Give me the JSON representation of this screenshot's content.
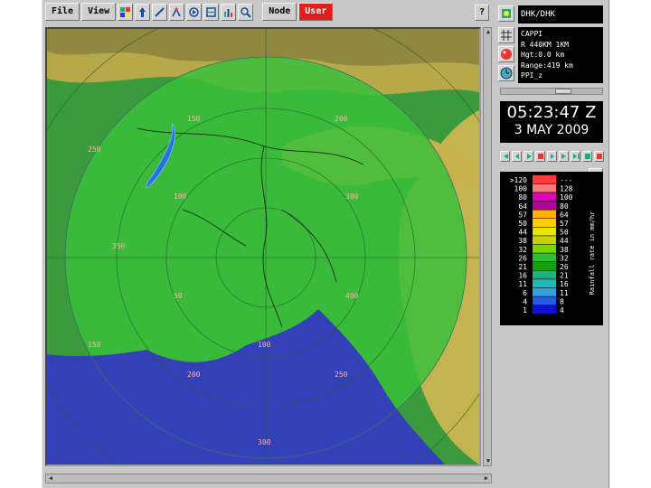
{
  "toolbar": {
    "file_label": "File",
    "view_label": "View",
    "node_label": "Node",
    "user_label": "User",
    "help_label": "?",
    "tool_icons": [
      "layers-icon",
      "up-arrow-icon",
      "line-icon",
      "cross-section-icon",
      "animation-icon",
      "overlay-icon",
      "statistics-icon",
      "zoom-icon"
    ]
  },
  "map": {
    "range_labels": [
      "50",
      "100",
      "150",
      "200",
      "250",
      "300",
      "350",
      "400"
    ]
  },
  "side": {
    "station": "DHK/DHK",
    "product_lines": [
      "CAPPI",
      "R 440KM 1KM",
      "Hgt:0.0 km",
      "Range:419 km",
      "PPI_z"
    ],
    "time": "05:23:47 Z",
    "date": "3 MAY 2009",
    "legend_title": "Rainfall rate in mm/hr",
    "dbz_labels": [
      ">120",
      "100",
      "80",
      "64",
      "57",
      "50",
      "44",
      "38",
      "32",
      "26",
      "21",
      "16",
      "11",
      "6",
      "4",
      "1"
    ],
    "rate_labels": [
      "---",
      "128",
      "100",
      "80",
      "64",
      "57",
      "50",
      "44",
      "38",
      "32",
      "26",
      "21",
      "16",
      "11",
      "8",
      "4"
    ],
    "legend_colors": [
      "#ff3b3b",
      "#ff7a7a",
      "#e000b8",
      "#b400a0",
      "#ffb000",
      "#ffd000",
      "#e6e600",
      "#c8d200",
      "#7ad600",
      "#30c030",
      "#10a010",
      "#20b080",
      "#20b8b8",
      "#30a0e0",
      "#2060e0",
      "#1010d0"
    ]
  },
  "colors": {
    "accent": "#e31c1c",
    "land": "#38a83a",
    "sea": "#2a3ec0",
    "hills": "#c8b848"
  }
}
